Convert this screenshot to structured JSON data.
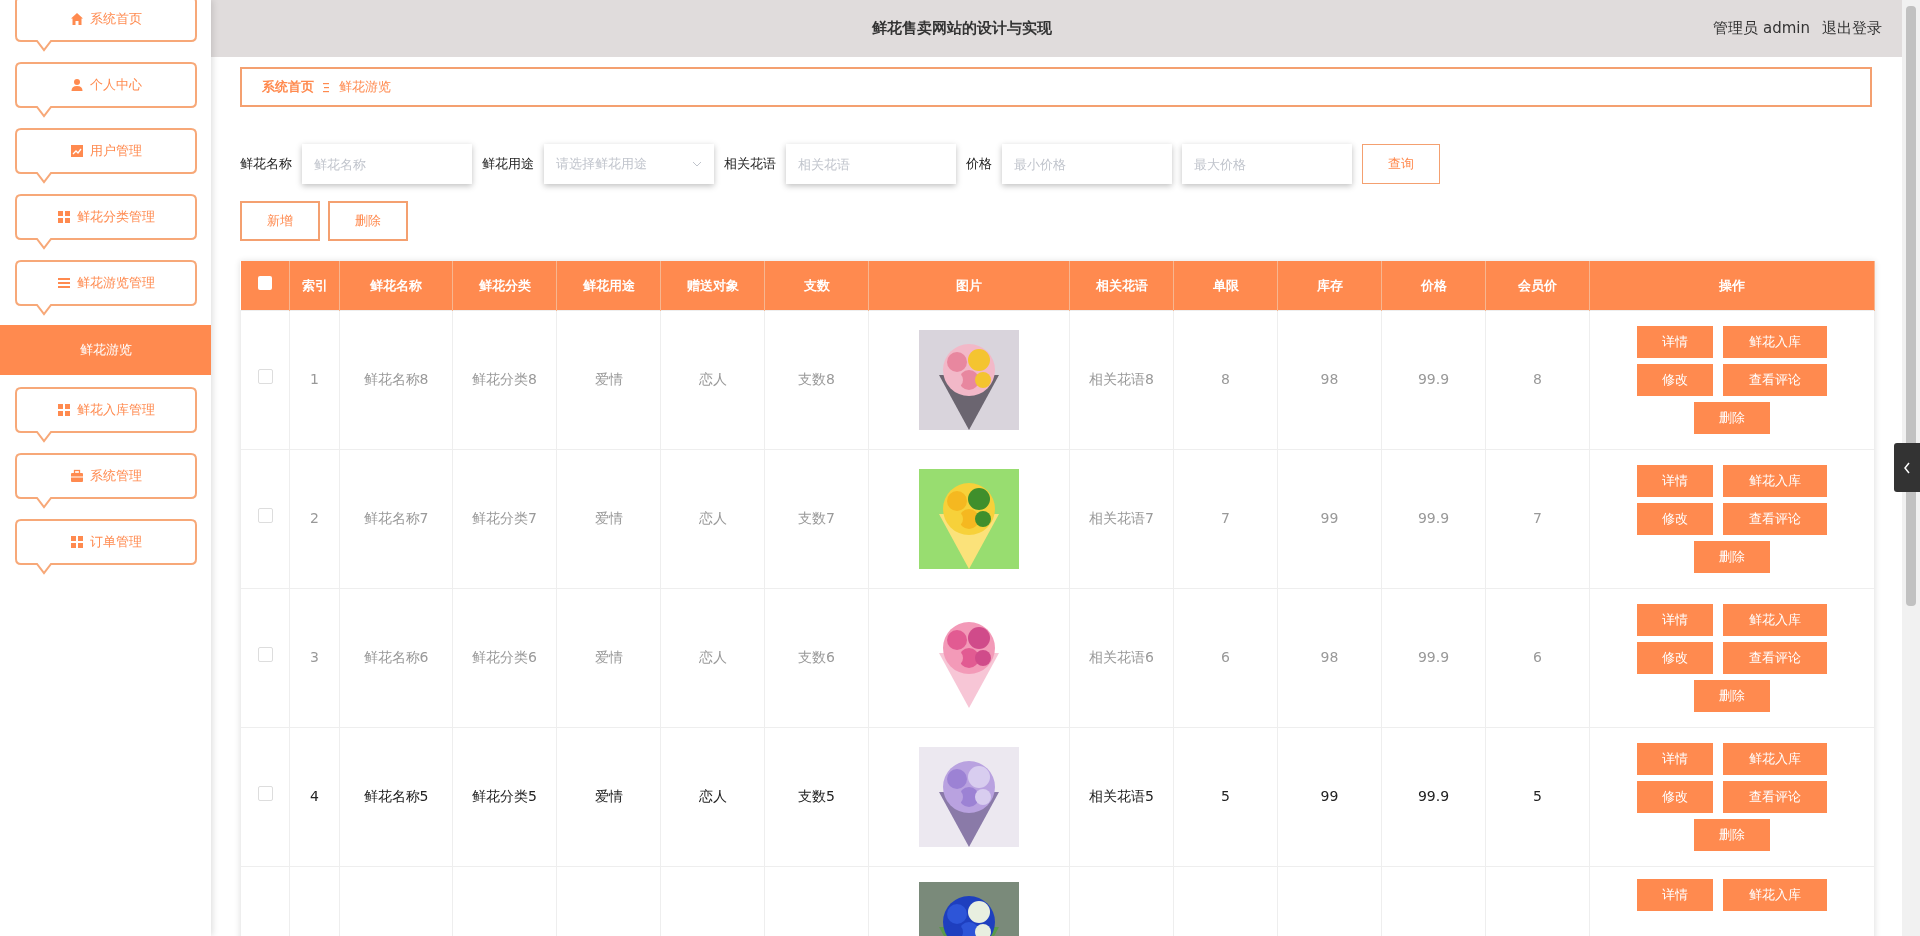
{
  "sidebar": {
    "items": [
      {
        "label": "系统首页",
        "selected": false
      },
      {
        "label": "个人中心",
        "selected": false
      },
      {
        "label": "用户管理",
        "selected": false
      },
      {
        "label": "鲜花分类管理",
        "selected": false
      },
      {
        "label": "鲜花游览管理",
        "selected": false,
        "children": [
          {
            "label": "鲜花游览",
            "selected": true
          }
        ]
      },
      {
        "label": "鲜花入库管理",
        "selected": false
      },
      {
        "label": "系统管理",
        "selected": false
      },
      {
        "label": "订单管理",
        "selected": false
      }
    ]
  },
  "header": {
    "title": "鲜花售卖网站的设计与实现",
    "user": "管理员 admin",
    "logout": "退出登录"
  },
  "breadcrumb": [
    "系统首页",
    "鲜花游览"
  ],
  "filters": [
    {
      "label": "鲜花名称",
      "fields": [
        {
          "kind": "input",
          "placeholder": "鲜花名称"
        }
      ]
    },
    {
      "label": "鲜花用途",
      "fields": [
        {
          "kind": "select",
          "placeholder": "请选择鲜花用途"
        }
      ]
    },
    {
      "label": "相关花语",
      "fields": [
        {
          "kind": "input",
          "placeholder": "相关花语"
        }
      ]
    },
    {
      "label": "价格",
      "fields": [
        {
          "kind": "input",
          "placeholder": "最小价格"
        },
        {
          "kind": "input",
          "placeholder": "最大价格"
        }
      ]
    }
  ],
  "query_button": "查询",
  "toolbar_buttons": [
    "新增",
    "删除"
  ],
  "table": {
    "select_all": {
      "checked": false
    },
    "columns": [
      "索引",
      "鲜花名称",
      "鲜花分类",
      "鲜花用途",
      "赠送对象",
      "支数",
      "图片",
      "相关花语",
      "单限",
      "库存",
      "价格",
      "会员价",
      "操作"
    ],
    "rows": [
      {
        "checked": false,
        "hovered": false,
        "cells": [
          "1",
          "鲜花名称8",
          "鲜花分类8",
          "爱情",
          "恋人",
          "支数8",
          {
            "kind": "picture"
          },
          "相关花语8",
          "8",
          "98",
          "99.9",
          "8"
        ],
        "actions": [
          "详情",
          "鲜花入库",
          "修改",
          "查看评论",
          "删除"
        ]
      },
      {
        "checked": false,
        "hovered": false,
        "cells": [
          "2",
          "鲜花名称7",
          "鲜花分类7",
          "爱情",
          "恋人",
          "支数7",
          {
            "kind": "picture"
          },
          "相关花语7",
          "7",
          "99",
          "99.9",
          "7"
        ],
        "actions": [
          "详情",
          "鲜花入库",
          "修改",
          "查看评论",
          "删除"
        ]
      },
      {
        "checked": false,
        "hovered": false,
        "cells": [
          "3",
          "鲜花名称6",
          "鲜花分类6",
          "爱情",
          "恋人",
          "支数6",
          {
            "kind": "picture"
          },
          "相关花语6",
          "6",
          "98",
          "99.9",
          "6"
        ],
        "actions": [
          "详情",
          "鲜花入库",
          "修改",
          "查看评论",
          "删除"
        ]
      },
      {
        "checked": false,
        "hovered": true,
        "cells": [
          "4",
          "鲜花名称5",
          "鲜花分类5",
          "爱情",
          "恋人",
          "支数5",
          {
            "kind": "picture"
          },
          "相关花语5",
          "5",
          "99",
          "99.9",
          "5"
        ],
        "actions": [
          "详情",
          "鲜花入库",
          "修改",
          "查看评论",
          "删除"
        ]
      },
      {
        "cells": [
          "",
          "",
          "",
          "",
          "",
          "",
          {
            "kind": "picture"
          }
        ],
        "actions": [
          "详情",
          "鲜花入库"
        ]
      }
    ]
  }
}
